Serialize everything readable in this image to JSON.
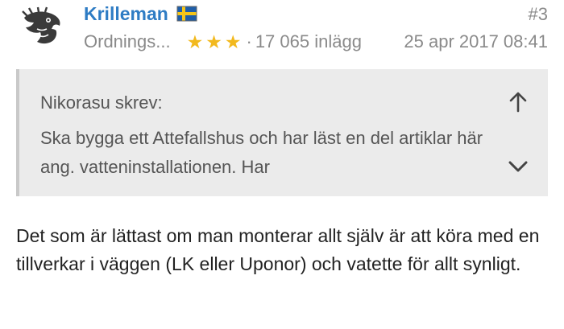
{
  "post": {
    "author": {
      "username": "Krilleman",
      "rank": "Ordnings...",
      "stars": 3,
      "post_count": "17 065 inlägg",
      "flag_icon": "sweden-flag-icon"
    },
    "separator": "·",
    "post_number": "#3",
    "timestamp": "25 apr 2017 08:41",
    "quote": {
      "author_line": "Nikorasu skrev:",
      "text": "Ska bygga ett Attefallshus och har läst en del artiklar här ang. vatteninstallationen. Har"
    },
    "body": "Det som är lättast om man monterar allt själv är att köra med en tillverkar i väggen (LK eller Uponor) och vatette för allt synligt."
  },
  "colors": {
    "username": "#2e7cc4",
    "stars": "#f2b91e",
    "meta": "#8a8a8a",
    "quote_bg": "#ebebeb"
  }
}
